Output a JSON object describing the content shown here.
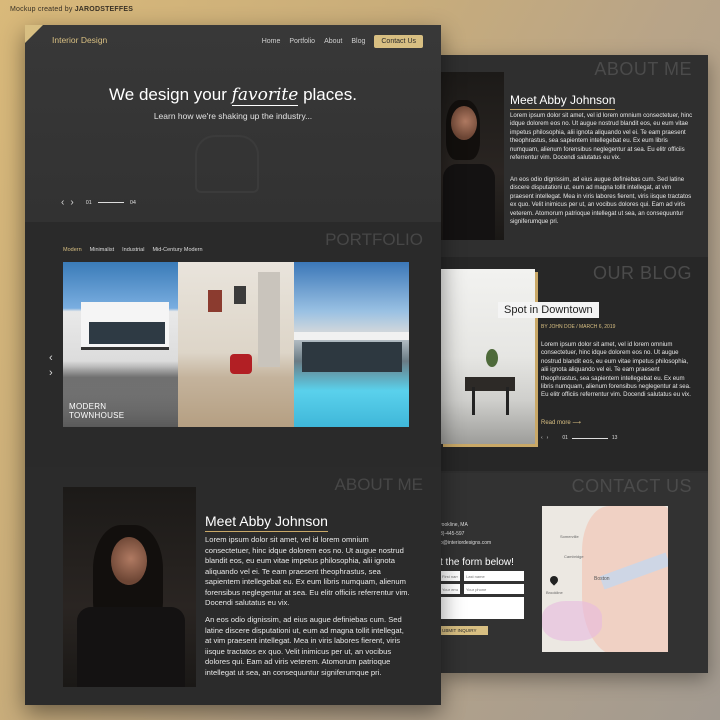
{
  "credit": {
    "prefix": "Mockup created by",
    "author": "JARODSTEFFES"
  },
  "front": {
    "logo": "Interior Design",
    "nav": [
      "Home",
      "Portfolio",
      "About",
      "Blog"
    ],
    "nav_cta": "Contact Us",
    "hero_title_a": "We design your",
    "hero_title_fav": "favorite",
    "hero_title_b": "places.",
    "hero_sub": "Learn how we're shaking up the industry...",
    "slider_start": "01",
    "slider_end": "04",
    "portfolio_title": "PORTFOLIO",
    "filters": [
      "Modern",
      "Minimalist",
      "Industrial",
      "Mid-Century Modern"
    ],
    "featured_label_1": "MODERN",
    "featured_label_2": "TOWNHOUSE",
    "about_title": "ABOUT ME",
    "meet": "Meet Abby Johnson",
    "para1": "Lorem ipsum dolor sit amet, vel id lorem omnium consectetuer, hinc idque dolorem eos no. Ut augue nostrud blandit eos, eu eum vitae impetus philosophia, alii ignota aliquando vel ei. Te eam praesent theophrastus, sea sapientem intellegebat eu. Ex eum libris numquam, alienum forensibus neglegentur at sea. Eu elitr officiis referrentur vim. Docendi salutatus eu vix.",
    "para2": "An eos odio dignissim, ad eius augue definiebas cum. Sed latine discere disputationi ut, eum ad magna tollit intellegat, at vim praesent intellegat. Mea in viris labores fierent, viris iisque tractatos ex quo. Velit inimicus per ut, an vocibus dolores qui. Eam ad viris veterem. Atomorum patrioque intellegat ut sea, an consequuntur signiferumque pri."
  },
  "back": {
    "about_title": "ABOUT ME",
    "meet": "Meet Abby Johnson",
    "blog_title": "OUR BLOG",
    "blog_post": "Spot in Downtown",
    "blog_meta": "BY JOHN DOE / MARCH 6, 2019",
    "blog_para": "Lorem ipsum dolor sit amet, vel id lorem omnium consectetuer, hinc idque dolorem eos no. Ut augue nostrud blandit eos, eu eum vitae impetus philosophia, alii ignota aliquando vel ei. Te eam praesent theophrastus, sea sapientem intellegebat eu. Ex eum libris numquam, alienum forensibus neglegentur at sea. Eu elitr officiis referrentur vim. Docendi salutatus eu vix.",
    "read_more": "Read more",
    "blog_slider_start": "01",
    "blog_slider_end": "13",
    "contact_title": "CONTACT US",
    "contact_address": "rookline, MA",
    "contact_phone": "3)-445-597",
    "contact_email": "o@interiordesigns.com",
    "form_title": "t the form below!",
    "first_name_ph": "First name",
    "last_name_ph": "Last name",
    "email_ph": "Your email",
    "phone_ph": "Your phone",
    "submit": "UBMIT INQUIRY",
    "map_labels": [
      "Somerville",
      "Cambridge",
      "Boston",
      "Brookline"
    ]
  }
}
